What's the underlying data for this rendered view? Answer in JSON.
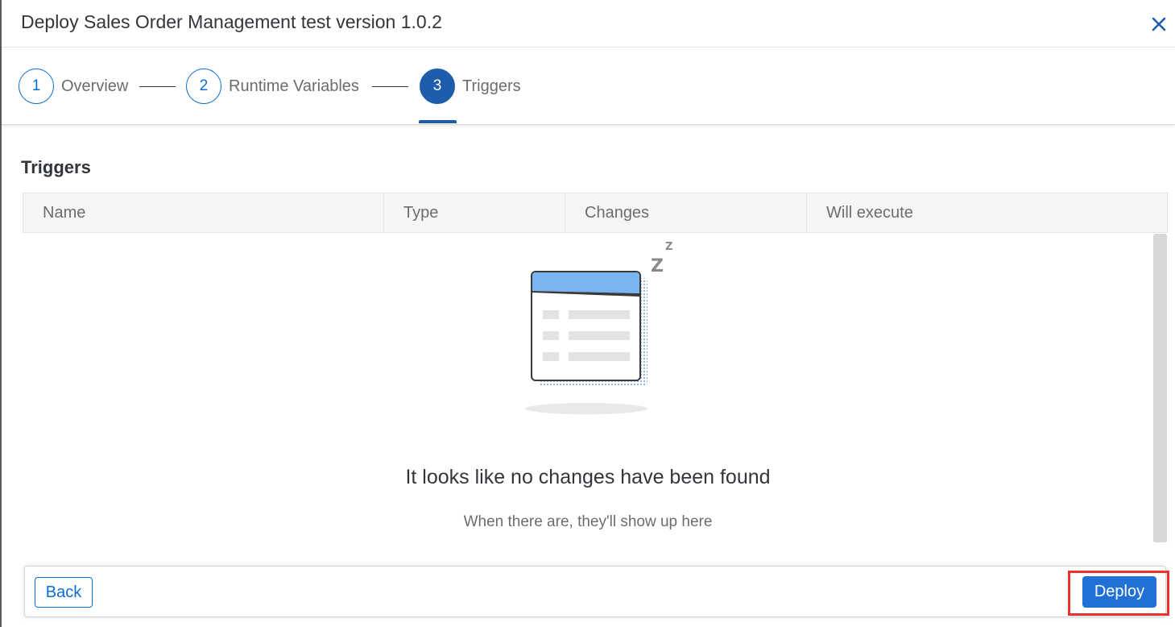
{
  "dialog": {
    "title": "Deploy Sales Order Management test version 1.0.2"
  },
  "wizard": {
    "steps": [
      {
        "number": "1",
        "label": "Overview"
      },
      {
        "number": "2",
        "label": "Runtime Variables"
      },
      {
        "number": "3",
        "label": "Triggers"
      }
    ],
    "active_step": "3"
  },
  "triggers": {
    "section_title": "Triggers",
    "columns": [
      "Name",
      "Type",
      "Changes",
      "Will execute"
    ],
    "empty_state": {
      "title": "It looks like no changes have been found",
      "subtitle": "When there are, they'll show up here",
      "illustration": "sleeping-empty-table-illustration"
    }
  },
  "footer": {
    "back_label": "Back",
    "deploy_label": "Deploy"
  },
  "colors": {
    "accent": "#0a6ed1",
    "active_step": "#1d5dab",
    "deploy_button": "#2170d6",
    "highlight_box": "#e8342f"
  },
  "icons": {
    "close": "close-icon"
  }
}
